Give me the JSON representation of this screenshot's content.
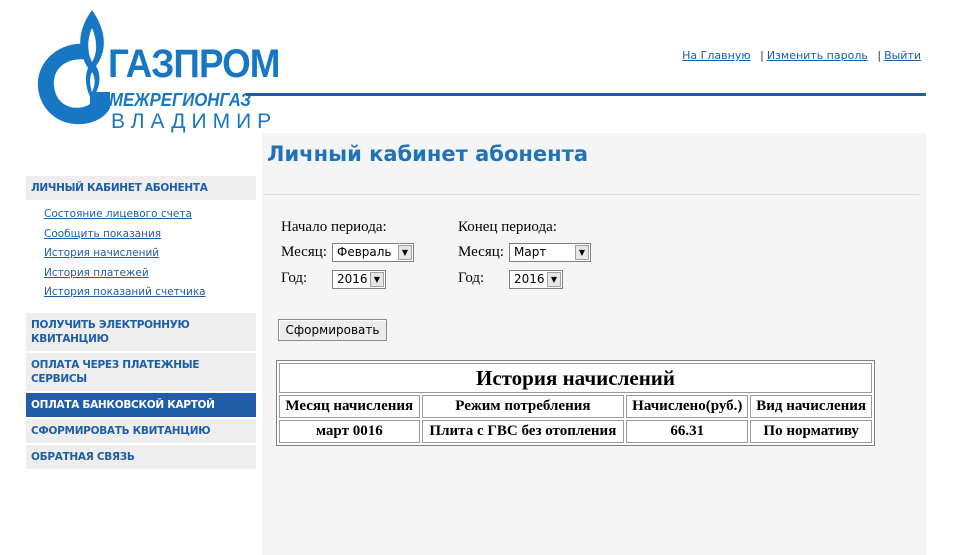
{
  "logo": {
    "line1": "ГАЗПРОМ",
    "line2": "МЕЖРЕГИОНГАЗ",
    "line3": "ВЛАДИМИР",
    "brand_color": "#1777c4"
  },
  "top_links": {
    "home": "На Главную",
    "change_password": "Изменить пароль",
    "logout": "Выйти",
    "separator": "|"
  },
  "page_title": "Личный кабинет абонента",
  "sidebar": {
    "section_title": "ЛИЧНЫЙ КАБИНЕТ АБОНЕНТА",
    "sub_items": [
      {
        "label": "Состояние лицевого счета"
      },
      {
        "label": "Сообщить показания"
      },
      {
        "label": "История начислений"
      },
      {
        "label": "История платежей"
      },
      {
        "label": "История показаний счетчика"
      }
    ],
    "items": [
      {
        "label": "ПОЛУЧИТЬ ЭЛЕКТРОННУЮ КВИТАНЦИЮ",
        "active": false
      },
      {
        "label": "ОПЛАТА ЧЕРЕЗ ПЛАТЕЖНЫЕ СЕРВИСЫ",
        "active": false
      },
      {
        "label": "ОПЛАТА БАНКОВСКОЙ КАРТОЙ",
        "active": true
      },
      {
        "label": "СФОРМИРОВАТЬ КВИТАНЦИЮ",
        "active": false
      },
      {
        "label": "ОБРАТНАЯ СВЯЗЬ",
        "active": false
      }
    ]
  },
  "form": {
    "start": {
      "title": "Начало периода:",
      "month_label": "Месяц:",
      "month_value": "Февраль",
      "year_label": "Год:",
      "year_value": "2016"
    },
    "end": {
      "title": "Конец периода:",
      "month_label": "Месяц:",
      "month_value": "Март",
      "year_label": "Год:",
      "year_value": "2016"
    },
    "submit_label": "Сформировать"
  },
  "history_table": {
    "caption": "История начислений",
    "columns": [
      "Месяц начисления",
      "Режим потребления",
      "Начислено(руб.)",
      "Вид начисления"
    ],
    "rows": [
      [
        "март 0016",
        "Плита с ГВС без отопления",
        "66.31",
        "По нормативу"
      ]
    ]
  },
  "colors": {
    "accent": "#1e5ea8",
    "active_bg": "#1f5ea6",
    "panel_bg": "#f5f5f5"
  }
}
